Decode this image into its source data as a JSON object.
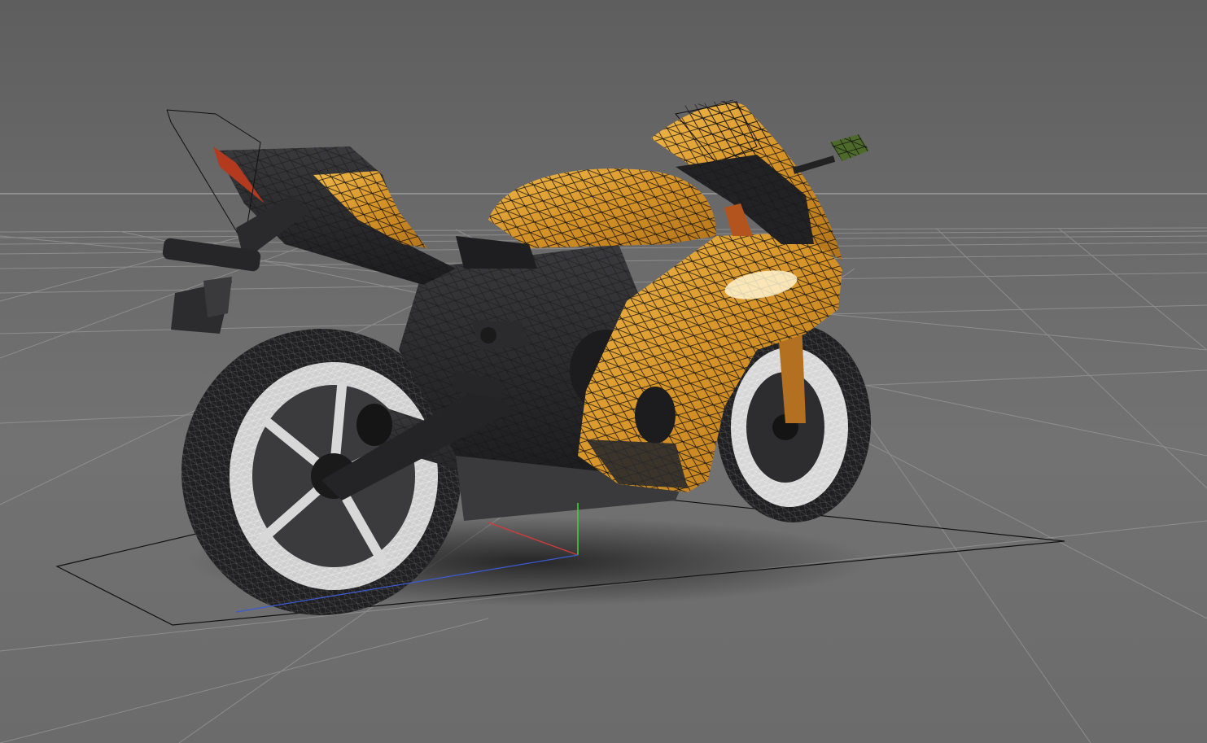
{
  "viewport": {
    "background_color": "#6c6c6c",
    "grid_color": "#9a9a9a",
    "horizon_color": "#a8a8a8"
  },
  "model": {
    "name": "sport-motorcycle",
    "display_mode": "shaded-wireframe",
    "fairing_color": "#d99a2b",
    "fairing_highlight": "#f3c15a",
    "body_dark_color": "#2a2a2c",
    "wire_color": "#111111"
  },
  "axis_gizmo": {
    "x_color": "#d23b3b",
    "y_color": "#3bd23b",
    "z_color": "#3b5bd2"
  }
}
